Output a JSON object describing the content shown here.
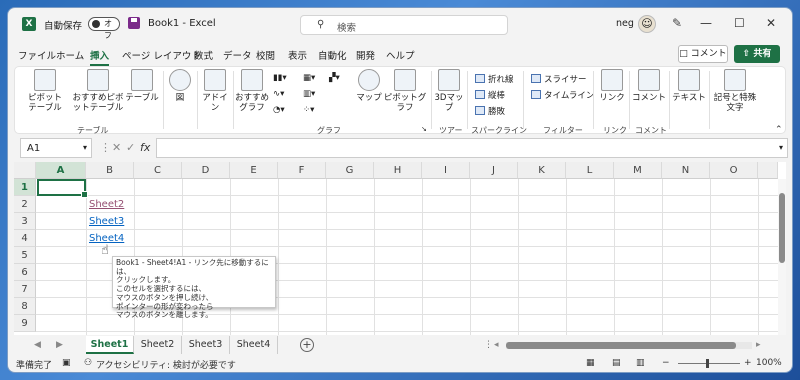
{
  "titlebar": {
    "autosave_label": "自動保存",
    "autosave_state": "オフ",
    "doc_title": "Book1  -  Excel",
    "search_placeholder": "検索",
    "user": "neg"
  },
  "menu_tabs": [
    "ファイル",
    "ホーム",
    "挿入",
    "ページ レイアウト",
    "数式",
    "データ",
    "校閲",
    "表示",
    "自動化",
    "開発",
    "ヘルプ"
  ],
  "active_tab": "挿入",
  "header_buttons": {
    "comment": "コメント",
    "share": "共有"
  },
  "ribbon": {
    "pivot_table": "ピボットテーブル",
    "recommended_pivot": "おすすめピボットテーブル",
    "table": "テーブル",
    "illustrations": "図",
    "addins": "アドイン",
    "recommended_charts": "おすすめグラフ",
    "maps": "マップ",
    "pivot_chart": "ピボットグラフ",
    "map3d": "3Dマップ",
    "spark_line": "折れ線",
    "spark_column": "縦棒",
    "spark_winloss": "勝敗",
    "slicer": "スライサー",
    "timeline": "タイムライン",
    "link": "リンク",
    "comment": "コメント",
    "text": "テキスト",
    "symbols": "記号と特殊文字",
    "groups": {
      "table": "テーブル",
      "charts": "グラフ",
      "tours": "ツアー",
      "sparklines": "スパークライン",
      "filters": "フィルター",
      "links": "リンク",
      "comments": "コメント"
    }
  },
  "formula_bar": {
    "name_box": "A1",
    "fx": "fx",
    "value": ""
  },
  "grid": {
    "columns": [
      "A",
      "B",
      "C",
      "D",
      "E",
      "F",
      "G",
      "H",
      "I",
      "J",
      "K",
      "L",
      "M",
      "N",
      "O"
    ],
    "rows": [
      "1",
      "2",
      "3",
      "4",
      "5",
      "6",
      "7",
      "8",
      "9"
    ],
    "links": [
      {
        "cell": "B2",
        "text": "Sheet2",
        "visited": true
      },
      {
        "cell": "B3",
        "text": "Sheet3",
        "visited": false
      },
      {
        "cell": "B4",
        "text": "Sheet4",
        "visited": false
      }
    ],
    "tooltip": [
      "Book1 - Sheet4!A1 - リンク先に移動するには、",
      "クリックします。",
      "このセルを選択するには、",
      "マウスのボタンを押し続け、",
      "ポインターの形が変わったら",
      "マウスのボタンを離します。"
    ]
  },
  "sheet_tabs": [
    "Sheet1",
    "Sheet2",
    "Sheet3",
    "Sheet4"
  ],
  "active_sheet": "Sheet1",
  "status": {
    "ready": "準備完了",
    "accessibility": "アクセシビリティ: 検討が必要です",
    "zoom": "100%"
  }
}
